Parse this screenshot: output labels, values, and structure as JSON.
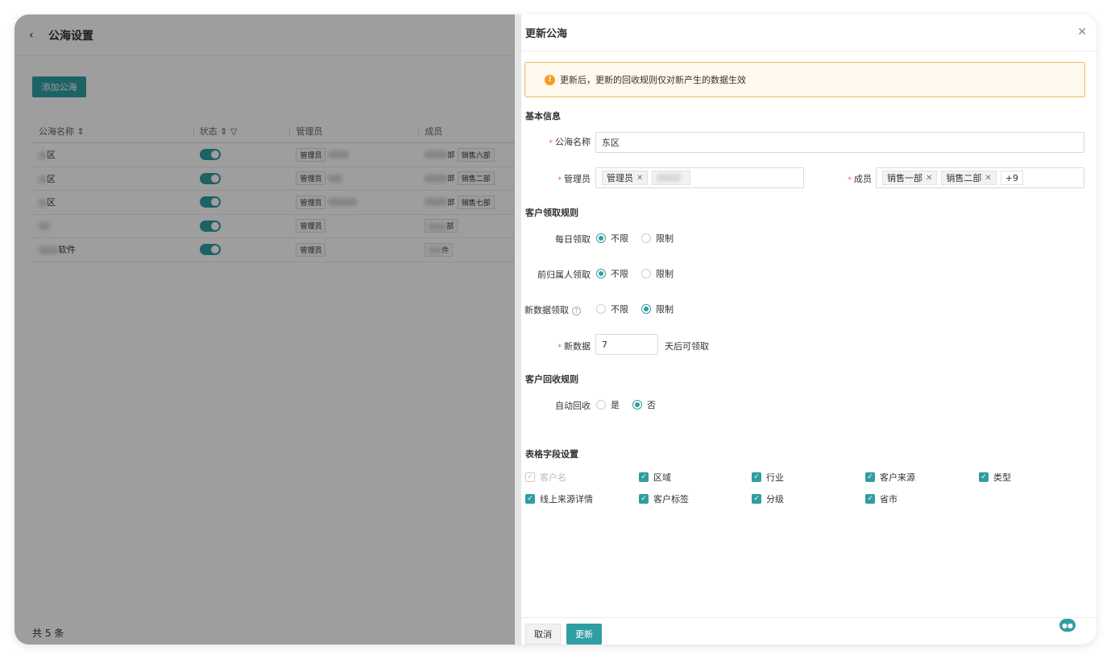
{
  "page": {
    "title": "公海设置",
    "add_button": "添加公海",
    "columns": [
      "公海名称",
      "状态",
      "管理员",
      "成员"
    ],
    "rows": [
      {
        "name": "区",
        "admin": "管理员",
        "members": [
          "部",
          "销售六部"
        ]
      },
      {
        "name": "区",
        "admin": "管理员",
        "members": [
          "部",
          "销售二部"
        ]
      },
      {
        "name": "区",
        "admin": "管理员",
        "members": [
          "部",
          "销售七部"
        ]
      },
      {
        "name": "",
        "admin": "管理员",
        "members": [
          "部"
        ]
      },
      {
        "name": "软件",
        "admin": "管理员",
        "members": [
          "件"
        ]
      }
    ],
    "total": "共 5 条"
  },
  "drawer": {
    "title": "更新公海",
    "alert": "更新后，更新的回收规则仅对新产生的数据生效",
    "basic_section": "基本信息",
    "name_label": "公海名称",
    "name_value": "东区",
    "admin_label": "管理员",
    "admin_tag": "管理员",
    "member_label": "成员",
    "member_tags": [
      "销售一部",
      "销售二部"
    ],
    "member_more": "+9",
    "claim_section": "客户领取规则",
    "daily_label": "每日领取",
    "prev_label": "前归属人领取",
    "new_label": "新数据领取",
    "opt_unlimited": "不限",
    "opt_limited": "限制",
    "newdata_label": "新数据",
    "newdata_value": "7",
    "newdata_suffix": "天后可领取",
    "recycle_section": "客户回收规则",
    "auto_label": "自动回收",
    "opt_yes": "是",
    "opt_no": "否",
    "fields_section": "表格字段设置",
    "fields": [
      "客户名",
      "区域",
      "行业",
      "客户来源",
      "类型",
      "线上来源详情",
      "客户标签",
      "分级",
      "省市"
    ],
    "cancel": "取消",
    "update": "更新"
  },
  "colors": {
    "accent": "#2f9ea3",
    "warning": "#f59a23"
  }
}
